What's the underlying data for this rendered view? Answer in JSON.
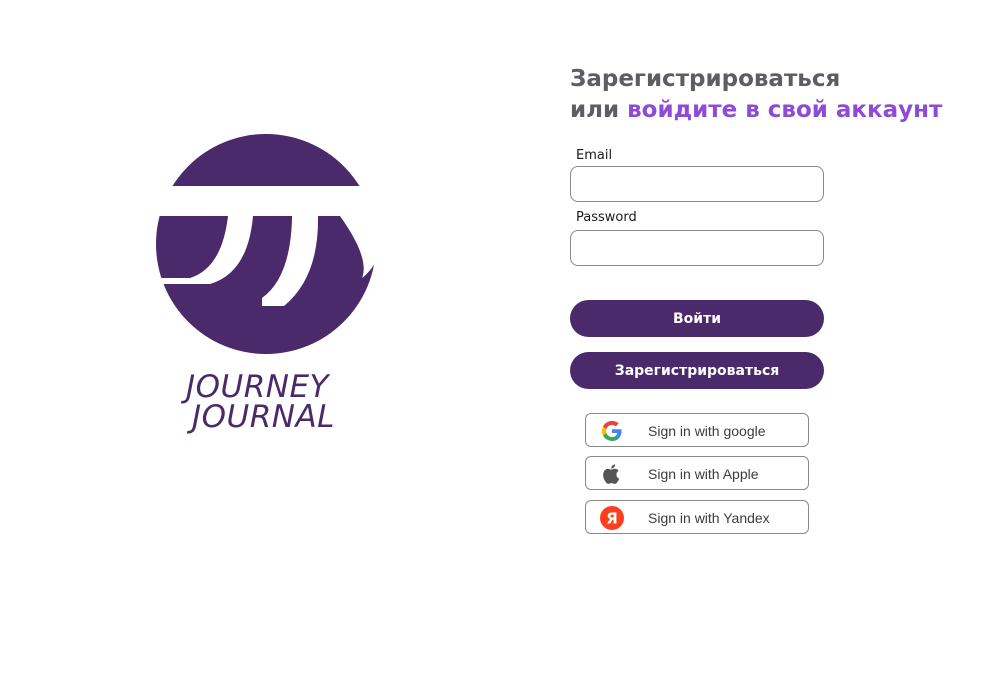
{
  "logo": {
    "line1": "JOURNEY",
    "line2": "JOURNAL",
    "brand_color": "#4a2a6b"
  },
  "heading": {
    "line1": "Зарегистрироваться",
    "line2_prefix": "или ",
    "line2_accent": "войдите в свой аккаунт",
    "text_color": "#5d5e64",
    "accent_color": "#8e4bd6"
  },
  "form": {
    "email_label": "Email",
    "email_value": "",
    "password_label": "Password",
    "password_value": "",
    "login_button": "Войти",
    "register_button": "Зарегистрироваться"
  },
  "social": [
    {
      "label": "Sign in with google",
      "icon": "google-icon"
    },
    {
      "label": "Sign in with Apple",
      "icon": "apple-icon"
    },
    {
      "label": "Sign in with Yandex",
      "icon": "yandex-icon"
    }
  ]
}
